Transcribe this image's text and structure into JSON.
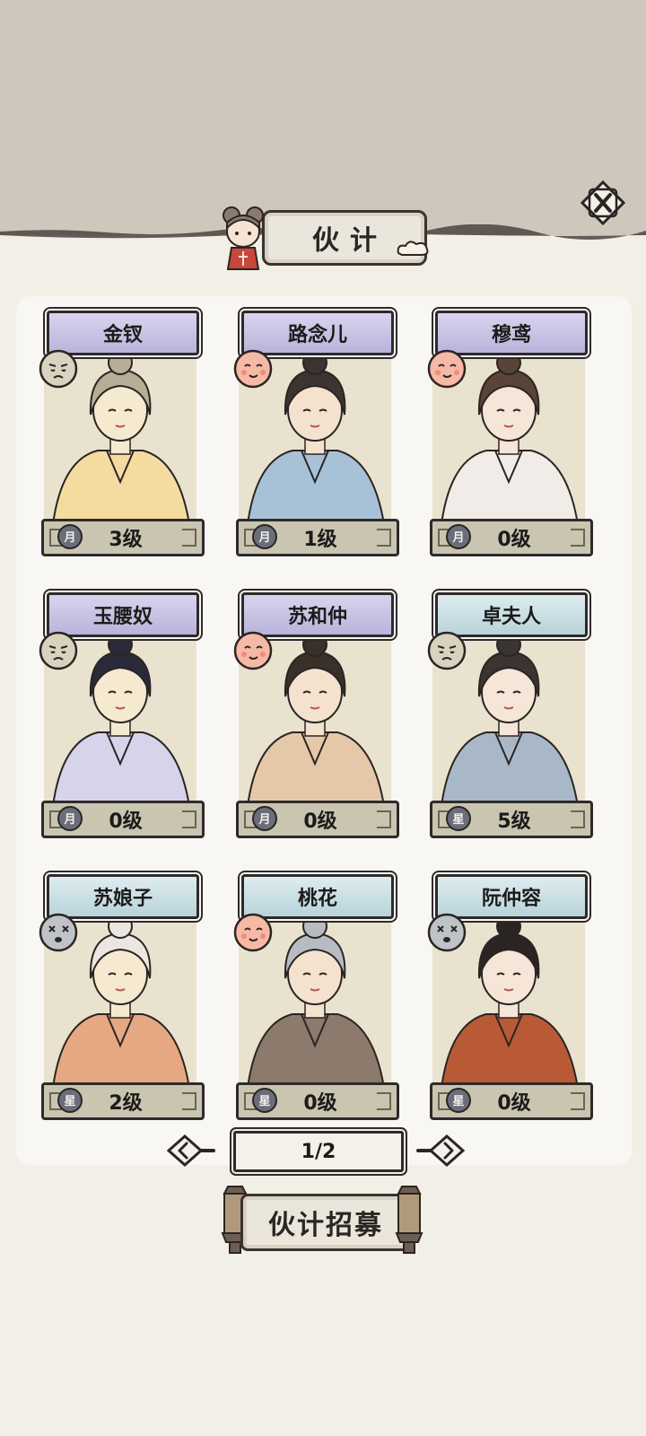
{
  "header": {
    "title": "伙计"
  },
  "cards": [
    {
      "name": "金钗",
      "level": "3级",
      "plate": "purple",
      "mood": "worried-icon",
      "rank_icon": "moon-rank-icon"
    },
    {
      "name": "路念儿",
      "level": "1级",
      "plate": "purple",
      "mood": "happy-icon",
      "rank_icon": "moon-rank-icon"
    },
    {
      "name": "穆鸢",
      "level": "0级",
      "plate": "purple",
      "mood": "happy-icon",
      "rank_icon": "moon-rank-icon"
    },
    {
      "name": "玉腰奴",
      "level": "0级",
      "plate": "purple",
      "mood": "worried-icon",
      "rank_icon": "moon-rank-icon"
    },
    {
      "name": "苏和仲",
      "level": "0级",
      "plate": "purple",
      "mood": "happy-icon",
      "rank_icon": "moon-rank-icon"
    },
    {
      "name": "卓夫人",
      "level": "5级",
      "plate": "blue",
      "mood": "worried-icon",
      "rank_icon": "star-rank-icon"
    },
    {
      "name": "苏娘子",
      "level": "2级",
      "plate": "blue",
      "mood": "knocked-out-icon",
      "rank_icon": "star-rank-icon"
    },
    {
      "name": "桃花",
      "level": "0级",
      "plate": "blue",
      "mood": "happy-icon",
      "rank_icon": "star-rank-icon"
    },
    {
      "name": "阮仲容",
      "level": "0级",
      "plate": "blue",
      "mood": "knocked-out-icon",
      "rank_icon": "star-rank-icon"
    }
  ],
  "pager": {
    "text": "1/2"
  },
  "recruit": {
    "label": "伙计招募"
  },
  "colors": {
    "background": "#f2efe6",
    "top_area": "#cfc6bc",
    "purple_plate": "#c6c1e4",
    "blue_plate": "#c8e0e6",
    "level_bar": "#c9c5b1",
    "ink": "#2f2a2a"
  }
}
